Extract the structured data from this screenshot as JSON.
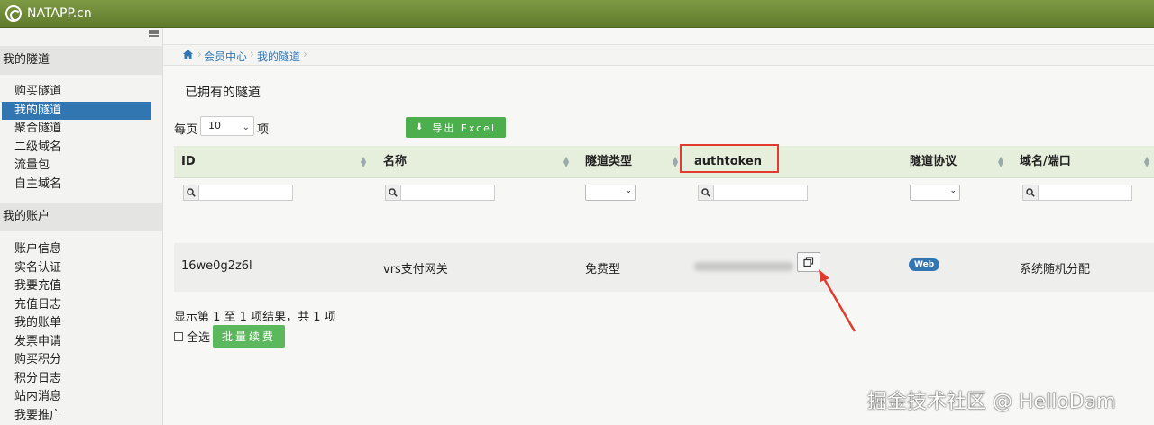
{
  "app": {
    "title": "NATAPP.cn"
  },
  "sidebar": {
    "sections": [
      {
        "title": "我的隧道",
        "items": [
          "购买隧道",
          "我的隧道",
          "聚合隧道",
          "二级域名",
          "流量包",
          "自主域名"
        ]
      },
      {
        "title": "我的账户",
        "items": [
          "账户信息",
          "实名认证",
          "我要充值",
          "充值日志",
          "我的账单",
          "发票申请",
          "购买积分",
          "积分日志",
          "站内消息",
          "我要推广"
        ]
      }
    ],
    "active_item": "我的隧道"
  },
  "breadcrumb": [
    "会员中心",
    "我的隧道"
  ],
  "page_title": "已拥有的隧道",
  "length": {
    "label": "每页",
    "value": "10",
    "unit": "项"
  },
  "export_label": "导出 Excel",
  "table": {
    "headers": [
      "ID",
      "名称",
      "隧道类型",
      "authtoken",
      "隧道协议",
      "域名/端口"
    ],
    "rows": [
      {
        "id": "16we0g2z6l",
        "name": "vrs支付网关",
        "type": "免费型",
        "protocol": "Web",
        "domain": "系统随机分配"
      }
    ]
  },
  "info_text": "显示第 1 至 1 项结果，共 1 项",
  "select_all_label": "全选",
  "renew_label": "批量续费",
  "watermark": "掘金技术社区 @ HelloDam",
  "colors": {
    "topbar": "#6f8a38",
    "accent": "#3276b1",
    "success": "#5cb85c",
    "annotation": "#e23b2e"
  }
}
